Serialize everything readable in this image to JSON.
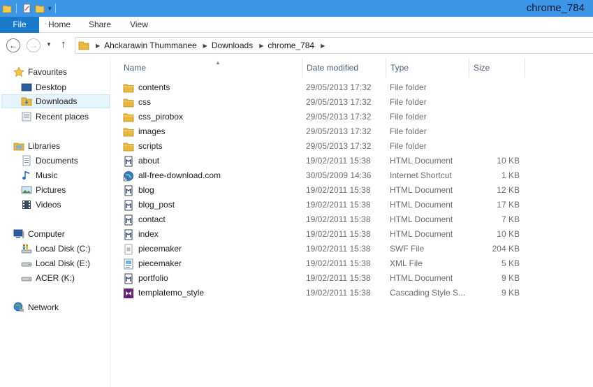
{
  "window": {
    "title": "chrome_784"
  },
  "ribbon": {
    "tabs": [
      {
        "label": "File"
      },
      {
        "label": "Home"
      },
      {
        "label": "Share"
      },
      {
        "label": "View"
      }
    ]
  },
  "address": {
    "crumbs": [
      {
        "label": "Ahckarawin Thummanee"
      },
      {
        "label": "Downloads"
      },
      {
        "label": "chrome_784"
      }
    ]
  },
  "navpane": {
    "favourites": {
      "label": "Favourites",
      "items": [
        {
          "label": "Desktop"
        },
        {
          "label": "Downloads"
        },
        {
          "label": "Recent places"
        }
      ]
    },
    "libraries": {
      "label": "Libraries",
      "items": [
        {
          "label": "Documents"
        },
        {
          "label": "Music"
        },
        {
          "label": "Pictures"
        },
        {
          "label": "Videos"
        }
      ]
    },
    "computer": {
      "label": "Computer",
      "items": [
        {
          "label": "Local Disk (C:)"
        },
        {
          "label": "Local Disk (E:)"
        },
        {
          "label": "ACER (K:)"
        }
      ]
    },
    "network": {
      "label": "Network"
    }
  },
  "columns": {
    "name": "Name",
    "date": "Date modified",
    "type": "Type",
    "size": "Size"
  },
  "files": [
    {
      "name": "contents",
      "date": "29/05/2013 17:32",
      "type": "File folder",
      "size": "",
      "icon": "folder-icon"
    },
    {
      "name": "css",
      "date": "29/05/2013 17:32",
      "type": "File folder",
      "size": "",
      "icon": "folder-icon"
    },
    {
      "name": "css_pirobox",
      "date": "29/05/2013 17:32",
      "type": "File folder",
      "size": "",
      "icon": "folder-icon"
    },
    {
      "name": "images",
      "date": "29/05/2013 17:32",
      "type": "File folder",
      "size": "",
      "icon": "folder-icon"
    },
    {
      "name": "scripts",
      "date": "29/05/2013 17:32",
      "type": "File folder",
      "size": "",
      "icon": "folder-icon"
    },
    {
      "name": "about",
      "date": "19/02/2011 15:38",
      "type": "HTML Document",
      "size": "10 KB",
      "icon": "html-document-icon"
    },
    {
      "name": "all-free-download.com",
      "date": "30/05/2009 14:36",
      "type": "Internet Shortcut",
      "size": "1 KB",
      "icon": "internet-shortcut-icon"
    },
    {
      "name": "blog",
      "date": "19/02/2011 15:38",
      "type": "HTML Document",
      "size": "12 KB",
      "icon": "html-document-icon"
    },
    {
      "name": "blog_post",
      "date": "19/02/2011 15:38",
      "type": "HTML Document",
      "size": "17 KB",
      "icon": "html-document-icon"
    },
    {
      "name": "contact",
      "date": "19/02/2011 15:38",
      "type": "HTML Document",
      "size": "7 KB",
      "icon": "html-document-icon"
    },
    {
      "name": "index",
      "date": "19/02/2011 15:38",
      "type": "HTML Document",
      "size": "10 KB",
      "icon": "html-document-icon"
    },
    {
      "name": "piecemaker",
      "date": "19/02/2011 15:38",
      "type": "SWF File",
      "size": "204 KB",
      "icon": "swf-file-icon"
    },
    {
      "name": "piecemaker",
      "date": "19/02/2011 15:38",
      "type": "XML File",
      "size": "5 KB",
      "icon": "xml-file-icon"
    },
    {
      "name": "portfolio",
      "date": "19/02/2011 15:38",
      "type": "HTML Document",
      "size": "9 KB",
      "icon": "html-document-icon"
    },
    {
      "name": "templatemo_style",
      "date": "19/02/2011 15:38",
      "type": "Cascading Style S...",
      "size": "9 KB",
      "icon": "css-file-icon"
    }
  ],
  "colors": {
    "titlebar": "#3b96e8",
    "file_tab": "#1979ca",
    "folder": "#e8b93c",
    "selected": "#e5f3fb"
  }
}
